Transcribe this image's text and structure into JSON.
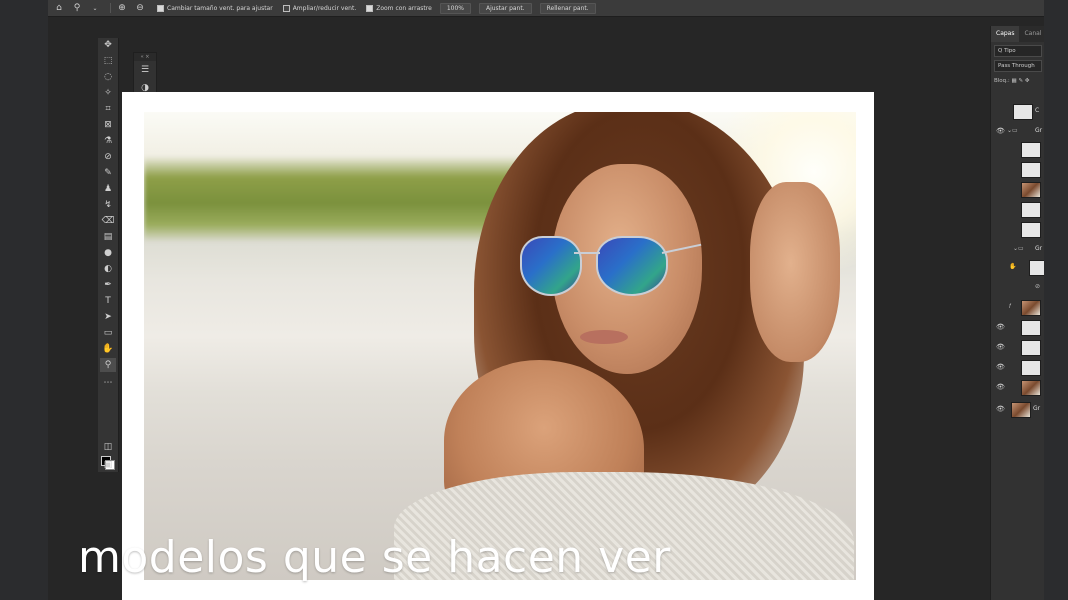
{
  "options_bar": {
    "checkbox_resize_label": "Cambiar tamaño vent. para ajustar",
    "checkbox_zoom_all_label": "Ampliar/reducir vent.",
    "checkbox_scrubby_label": "Zoom con arrastre",
    "zoom_value": "100%",
    "fit_screen_label": "Ajustar pant.",
    "fill_screen_label": "Rellenar pant."
  },
  "layers_panel": {
    "tab_layers": "Capas",
    "tab_channels": "Canal",
    "filter_text": "Q Tipo",
    "blend_mode": "Pass Through",
    "lock_label": "Bloq.:",
    "group_name_1": "Gr",
    "group_name_2": "Gr",
    "top_layer_letter": "C",
    "bottom_layer_name": "Gr"
  },
  "caption": {
    "text": "modelos que se hacen ver"
  },
  "colors": {
    "app_bg": "#262626",
    "panel_bg": "#323232",
    "canvas_bg": "#ffffff",
    "caption_color": "#ffffff"
  }
}
